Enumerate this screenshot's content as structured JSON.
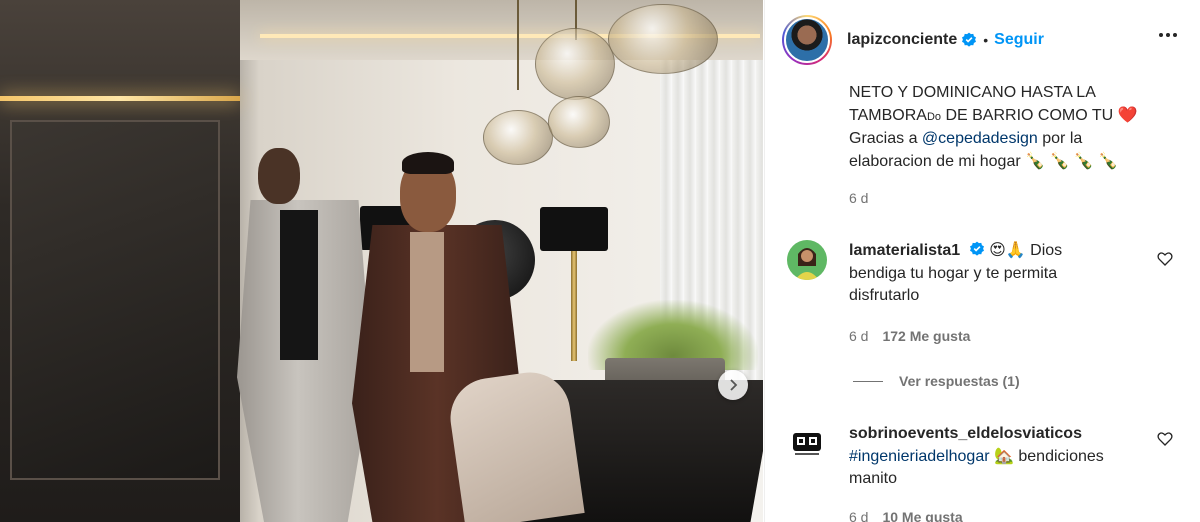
{
  "post": {
    "username": "lapizconciente",
    "follow_label": "Seguir",
    "separator": "•",
    "caption_line1": "NETO Y DOMINICANO HASTA LA",
    "caption_line2a": "TAMBORA",
    "caption_line2_small": "Do",
    "caption_line2b": " DE BARRIO COMO TU ",
    "caption_heart": "❤️",
    "caption_line3a": "Gracias a ",
    "caption_mention": "@cepedadesign",
    "caption_line3b": " por la",
    "caption_line4": "elaboracion de mi hogar ",
    "caption_emojis": "🍾 🍾 🍾 🍾",
    "time": "6 d"
  },
  "comments": [
    {
      "username": "lamaterialista1",
      "emojis": "😍🙏",
      "text_line1": " Dios",
      "text_line2": "bendiga tu hogar y te permita",
      "text_line3": "disfrutarlo",
      "time": "6 d",
      "likes": "172 Me gusta",
      "replies_label": "Ver respuestas (1)"
    },
    {
      "username": "sobrinoevents_eldelosviaticos",
      "hashtag": "#ingenieriadelhogar",
      "emoji": "🏡",
      "text_line1": " bendiciones",
      "text_line2": "manito",
      "time": "6 d",
      "likes": "10 Me gusta"
    }
  ],
  "icons": {
    "verified": "verified-badge-icon",
    "more": "more-options-icon",
    "heart": "heart-outline-icon",
    "next": "chevron-right-icon"
  },
  "colors": {
    "link_blue": "#0095f6",
    "mention": "#00376b",
    "secondary_text": "#737373"
  }
}
